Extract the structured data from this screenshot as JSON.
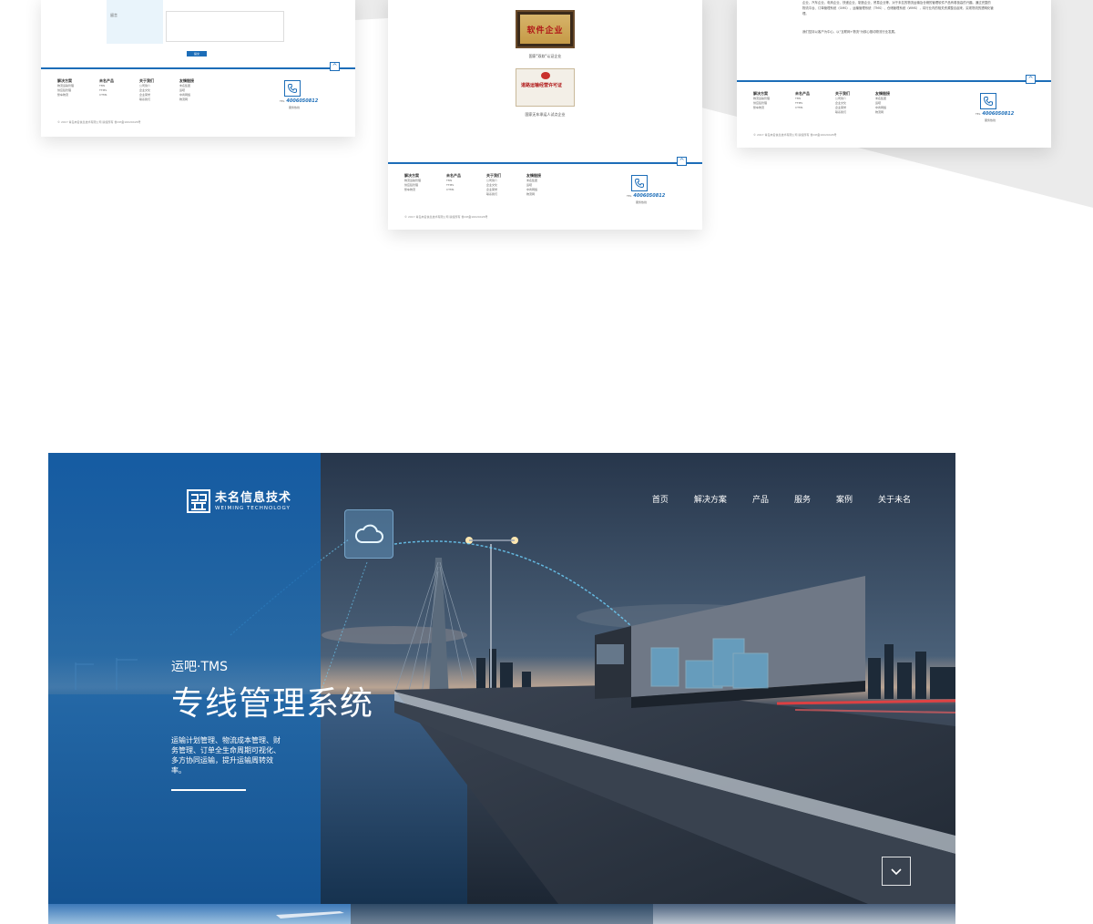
{
  "colors": {
    "brand_blue": "#1c6db8",
    "panel_blue": "#1e6eb4",
    "band_grey": "#ebebeb"
  },
  "card1": {
    "form_label": "留言",
    "submit_label": "提交"
  },
  "footer": {
    "columns": [
      {
        "title": "解决方案",
        "items": [
          "物流运输管理",
          "供应链管理",
          "整车物流"
        ]
      },
      {
        "title": "未名产品",
        "items": [
          "TMS",
          "TTMS",
          "CTMS"
        ]
      },
      {
        "title": "关于我们",
        "items": [
          "公司简介",
          "企业文化",
          "企业荣誉",
          "联系我们"
        ]
      },
      {
        "title": "友情链接",
        "items": [
          "未名集团",
          "运吧",
          "中商网络",
          "物流网"
        ]
      }
    ],
    "phone_label": "TEL",
    "phone": "4006050812",
    "phone_sub": "服务热线",
    "copyright": "© 2017 青岛未名信息技术有限公司 版权所有 鲁ICP备16020426号"
  },
  "card2": {
    "cert1_text": "软件企业",
    "cert1_caption": "国家\"双软\"认证企业",
    "cert2_text": "道路运输经营许可证",
    "cert2_caption": "国家无车承运人试点企业"
  },
  "card3": {
    "paragraph": "企业、汽车企业、电商企业、快递企业、制造企业、贸易企业等，对于未名的物流运输及仓储的管理软件产品有着极高的兴趣。通过完整的物流平台、订单管理系统（OMS）、运输管理系统（TMS）、仓储管理系统（WMS），将行业内的相关资源整合起来，实现物流的透明化管理。",
    "paragraph2": "我们坚持以客户为中心，以\"互联网+物流\"为核心推动物流行业发展。"
  },
  "hero": {
    "logo_cn": "未名信息技术",
    "logo_en": "WEIMING TECHNOLOGY",
    "nav": [
      "首页",
      "解决方案",
      "产品",
      "服务",
      "案例",
      "关于未名"
    ],
    "subtitle": "运吧·TMS",
    "title": "专线管理系统",
    "description": "运输计划管理、物流成本管理、财务管理、订单全生命周期可视化、多方协同运输，提升运输周转效率。",
    "cloud_icon": "cloud-icon",
    "down_icon": "chevron-down-icon"
  }
}
